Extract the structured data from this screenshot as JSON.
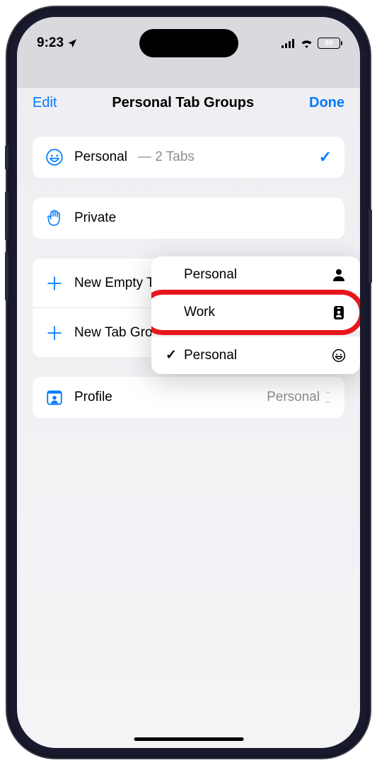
{
  "status": {
    "time": "9:23",
    "battery": "89"
  },
  "nav": {
    "left": "Edit",
    "title": "Personal Tab Groups",
    "right": "Done"
  },
  "groups": {
    "personal": {
      "label": "Personal",
      "suffix": " — 2 Tabs"
    },
    "private": {
      "label": "Private"
    },
    "new_empty": {
      "label": "New Empty Tab Group"
    },
    "new_from": {
      "label": "New Tab Group from 2 Tabs"
    }
  },
  "popup": {
    "items": [
      {
        "label": "Personal",
        "checked": false,
        "icon": "person"
      },
      {
        "label": "Work",
        "checked": false,
        "icon": "badge"
      },
      {
        "label": "Personal",
        "checked": true,
        "icon": "smile"
      }
    ]
  },
  "profile": {
    "label": "Profile",
    "value": "Personal"
  }
}
